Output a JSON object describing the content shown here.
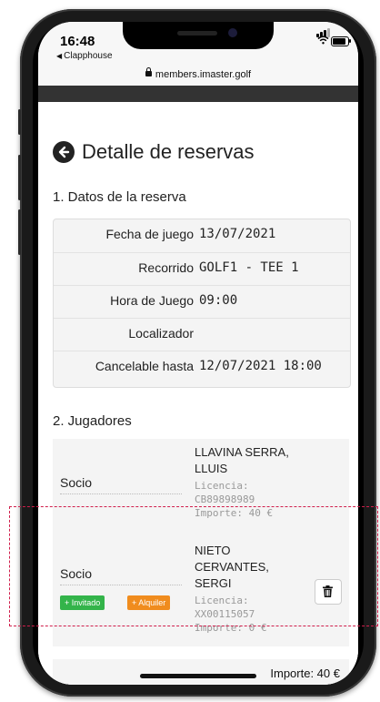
{
  "statusbar": {
    "time": "16:48",
    "back_app": "Clapphouse",
    "url": "members.imaster.golf"
  },
  "page": {
    "title": "Detalle de reservas",
    "section1": "1. Datos de la reserva",
    "section2": "2. Jugadores"
  },
  "details": [
    {
      "label": "Fecha de juego",
      "value": "13/07/2021"
    },
    {
      "label": "Recorrido",
      "value": "GOLF1 - TEE 1"
    },
    {
      "label": "Hora de Juego",
      "value": "09:00"
    },
    {
      "label": "Localizador",
      "value": ""
    },
    {
      "label": "Cancelable hasta",
      "value": "12/07/2021 18:00"
    }
  ],
  "players": [
    {
      "role": "Socio",
      "name": "LLAVINA SERRA, LLUIS",
      "license_label": "Licencia:",
      "license": "CB89898989",
      "amount": "Importe: 40 €"
    },
    {
      "role": "Socio",
      "name": "NIETO CERVANTES, SERGI",
      "license_label": "Licencia:",
      "license": "XX00115057",
      "amount": "Importe: 0 €",
      "guest_button": "+ Invitado",
      "rent_button": "+ Alquiler"
    }
  ],
  "total": "Importe: 40 €",
  "colors": {
    "highlight_dash": "#d01f4c",
    "guest_green": "#33b44a",
    "rent_orange": "#f08c1e"
  }
}
